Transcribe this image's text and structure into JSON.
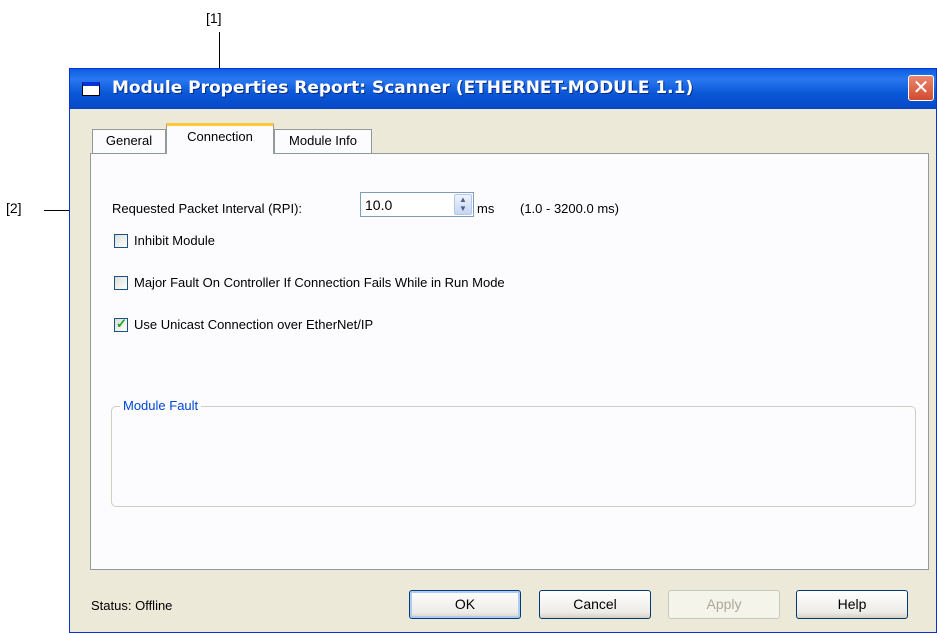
{
  "callouts": {
    "one": "[1]",
    "two": "[2]"
  },
  "window": {
    "title": "Module Properties Report: Scanner (ETHERNET-MODULE 1.1)",
    "close_glyph": "✕"
  },
  "tabs": [
    {
      "label": "General"
    },
    {
      "label": "Connection"
    },
    {
      "label": "Module Info"
    }
  ],
  "connection": {
    "rpi_label": "Requested Packet Interval (RPI):",
    "rpi_value": "10.0",
    "rpi_unit": "ms",
    "rpi_range": "(1.0 - 3200.0 ms)",
    "options": [
      {
        "label": "Inhibit Module",
        "checked": false
      },
      {
        "label": "Major Fault On Controller If Connection Fails While in Run Mode",
        "checked": false
      },
      {
        "label": "Use Unicast Connection over EtherNet/IP",
        "checked": true
      }
    ],
    "module_fault_label": "Module Fault"
  },
  "status": {
    "text": "Status:  Offline"
  },
  "buttons": {
    "ok": "OK",
    "cancel": "Cancel",
    "apply": "Apply",
    "help": "Help"
  },
  "colors": {
    "title_bar": "#0a58d8",
    "close": "#d24b2f",
    "tab_highlight": "#ffc83c",
    "group_label": "#0046d5"
  }
}
